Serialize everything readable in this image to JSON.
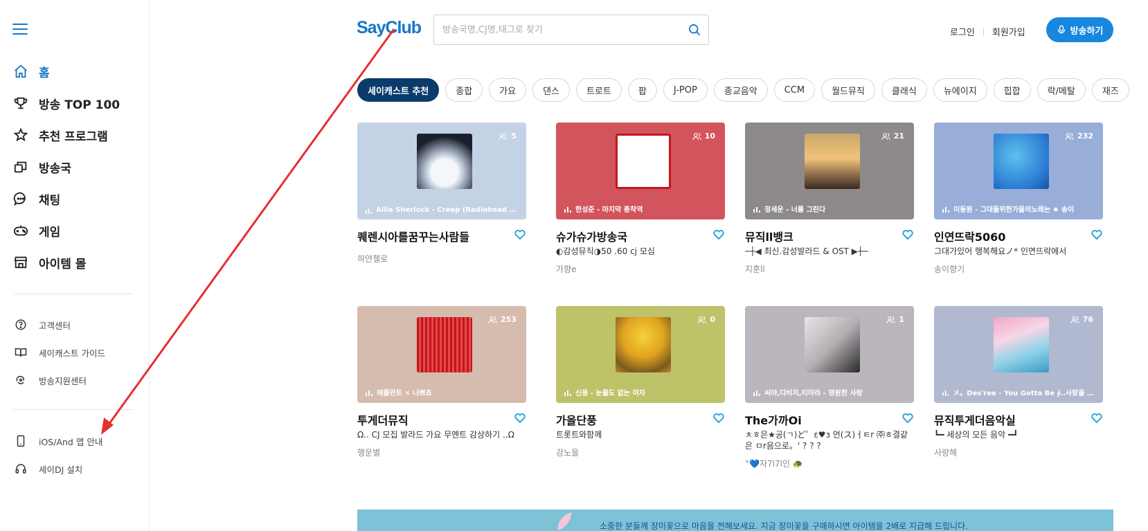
{
  "sidebar": {
    "main_items": [
      {
        "label": "홈",
        "icon": "home-icon"
      },
      {
        "label": "방송 TOP 100",
        "icon": "trophy-icon"
      },
      {
        "label": "추천 프로그램",
        "icon": "star-icon"
      },
      {
        "label": "방송국",
        "icon": "stations-icon"
      },
      {
        "label": "채팅",
        "icon": "chat-icon"
      },
      {
        "label": "게임",
        "icon": "gamepad-icon"
      },
      {
        "label": "아이템 몰",
        "icon": "shop-icon"
      }
    ],
    "help_items": [
      {
        "label": "고객센터",
        "icon": "question-icon"
      },
      {
        "label": "세이캐스트 가이드",
        "icon": "book-icon"
      },
      {
        "label": "방송지원센터",
        "icon": "support-icon"
      }
    ],
    "app_items": [
      {
        "label": "iOS/And 앱 안내",
        "icon": "phone-icon"
      },
      {
        "label": "세이DJ 설치",
        "icon": "headphones-icon"
      }
    ]
  },
  "header": {
    "logo": "SayClub",
    "search_placeholder": "방송국명,CJ명,태그로 찾기",
    "login": "로그인",
    "signup": "회원가입",
    "broadcast": "방송하기"
  },
  "genres": [
    "세이캐스트 추천",
    "종합",
    "가요",
    "댄스",
    "트로트",
    "팝",
    "J-POP",
    "종교음악",
    "CCM",
    "월드뮤직",
    "클래식",
    "뉴에이지",
    "힙합",
    "락/메탈",
    "재즈"
  ],
  "cards": [
    {
      "listeners": "5",
      "song": "Allie Sherlock - Creep (Radiohead cover)",
      "title": "퀘렌시아를꿈꾸는사람들",
      "desc": "",
      "owner": "하얀첼로"
    },
    {
      "listeners": "10",
      "song": "한성준 - 마지막 종착역",
      "title": "슈가슈가방송국",
      "desc": "◐감성뮤직◑50 .60 cj 모심",
      "owner": "가향e"
    },
    {
      "listeners": "21",
      "song": "정세운 - 너를 그린다",
      "title": "뮤직ll뱅크",
      "desc": "─┼◀ 최신.감성발라드 & OST ▶┼─",
      "owner": "지훈ll"
    },
    {
      "listeners": "232",
      "song": "이동원 - 그대들위한가을의노래는 ♠ 송이",
      "title": "인연뜨락5060",
      "desc": "그대가있어 행복해요ノ* 인연뜨락에서",
      "owner": "송이향기"
    },
    {
      "listeners": "253",
      "song": "에플민트 ✕ 나쁘죠",
      "title": "투게더뮤직",
      "desc": "Ω.. CJ 모집 발라드 가요 무멘트 감상하기 ..Ω",
      "owner": "행운별"
    },
    {
      "listeners": "0",
      "song": "신용 - 눈물도 없는 여자",
      "title": "가을단풍",
      "desc": "트롯트와함께",
      "owner": "강노을"
    },
    {
      "listeners": "1",
      "song": "씨야,다비치,티아라 - 영원한 사랑",
      "title": "The가까Oi",
      "desc": "ㅊㅎ은★공(ㄱ)ど゜ε♥з 언(ス)ㅓㅌr ㈜ㅎ결같은 ㅁr음으로。' ? ? ?",
      "owner": "°💙자7l7l인 🐢"
    },
    {
      "listeners": "76",
      "song": "メ。Des'ree - You Gotta Be ∮‥사랑을 나누다",
      "title": "뮤직투게더음악실",
      "desc": "┗━ 세상의 모든 음악 ━┛",
      "owner": "사랑해"
    }
  ],
  "banner": {
    "text": "소중한 분들께 장미꽃으로 마음을 전해보세요. 지금 장미꽃을 구매하시면 아이템을 2배로 지급해 드립니다."
  },
  "colors": {
    "accent": "#1877c9",
    "active_chip": "#0b3b6b",
    "broadcast_button": "#1787e0",
    "annotation_arrow": "#e53030"
  }
}
